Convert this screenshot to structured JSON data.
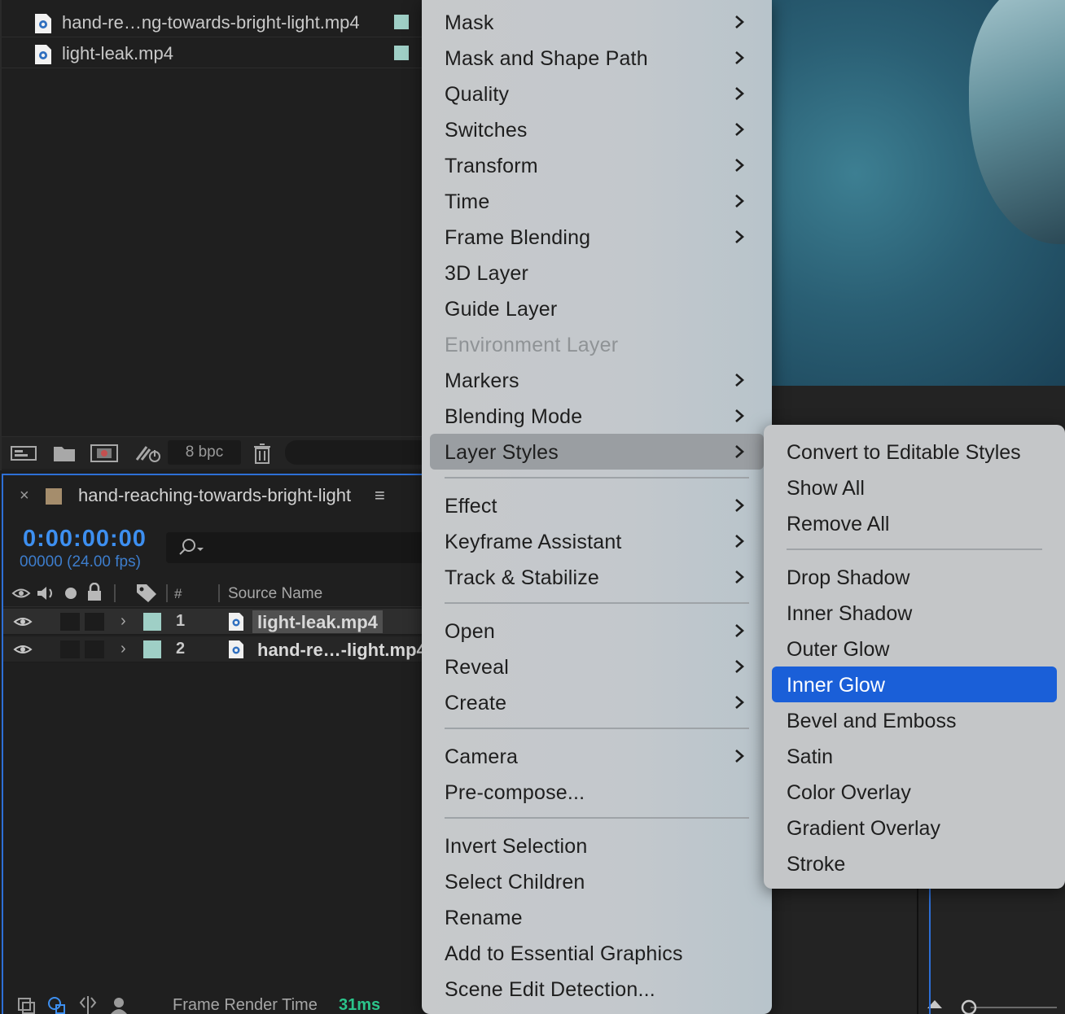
{
  "project": {
    "files": [
      {
        "name": "hand-re…ng-towards-bright-light.mp4"
      },
      {
        "name": "light-leak.mp4"
      }
    ],
    "toolbar": {
      "bpc": "8 bpc"
    }
  },
  "timeline": {
    "comp_name": "hand-reaching-towards-bright-light",
    "timecode": "0:00:00:00",
    "frames": "00000 (24.00 fps)",
    "columns": {
      "num": "#",
      "source": "Source Name"
    },
    "layers": [
      {
        "num": "1",
        "name": "light-leak.mp4"
      },
      {
        "num": "2",
        "name": "hand-re…-light.mp4"
      }
    ],
    "footer": {
      "label": "Frame Render Time",
      "value": "31ms"
    }
  },
  "menu": {
    "items": [
      {
        "label": "Mask"
      },
      {
        "label": "Mask and Shape Path"
      },
      {
        "label": "Quality"
      },
      {
        "label": "Switches"
      },
      {
        "label": "Transform"
      },
      {
        "label": "Time"
      },
      {
        "label": "Frame Blending"
      },
      {
        "label": "3D Layer"
      },
      {
        "label": "Guide Layer"
      },
      {
        "label": "Environment Layer"
      },
      {
        "label": "Markers"
      },
      {
        "label": "Blending Mode"
      },
      {
        "label": "Layer Styles"
      },
      {
        "label": "Effect"
      },
      {
        "label": "Keyframe Assistant"
      },
      {
        "label": "Track & Stabilize"
      },
      {
        "label": "Open"
      },
      {
        "label": "Reveal"
      },
      {
        "label": "Create"
      },
      {
        "label": "Camera"
      },
      {
        "label": "Pre-compose..."
      },
      {
        "label": "Invert Selection"
      },
      {
        "label": "Select Children"
      },
      {
        "label": "Rename"
      },
      {
        "label": "Add to Essential Graphics"
      },
      {
        "label": "Scene Edit Detection..."
      }
    ]
  },
  "submenu": {
    "items": [
      {
        "label": "Convert to Editable Styles"
      },
      {
        "label": "Show All"
      },
      {
        "label": "Remove All"
      },
      {
        "label": "Drop Shadow"
      },
      {
        "label": "Inner Shadow"
      },
      {
        "label": "Outer Glow"
      },
      {
        "label": "Inner Glow"
      },
      {
        "label": "Bevel and Emboss"
      },
      {
        "label": "Satin"
      },
      {
        "label": "Color Overlay"
      },
      {
        "label": "Gradient Overlay"
      },
      {
        "label": "Stroke"
      }
    ]
  },
  "colors": {
    "accent": "#1a5fd8",
    "timecode": "#3d8ff0",
    "render_time": "#2bc58b",
    "layer_label": "#9fcfc6",
    "comp_label": "#a58d6c"
  }
}
